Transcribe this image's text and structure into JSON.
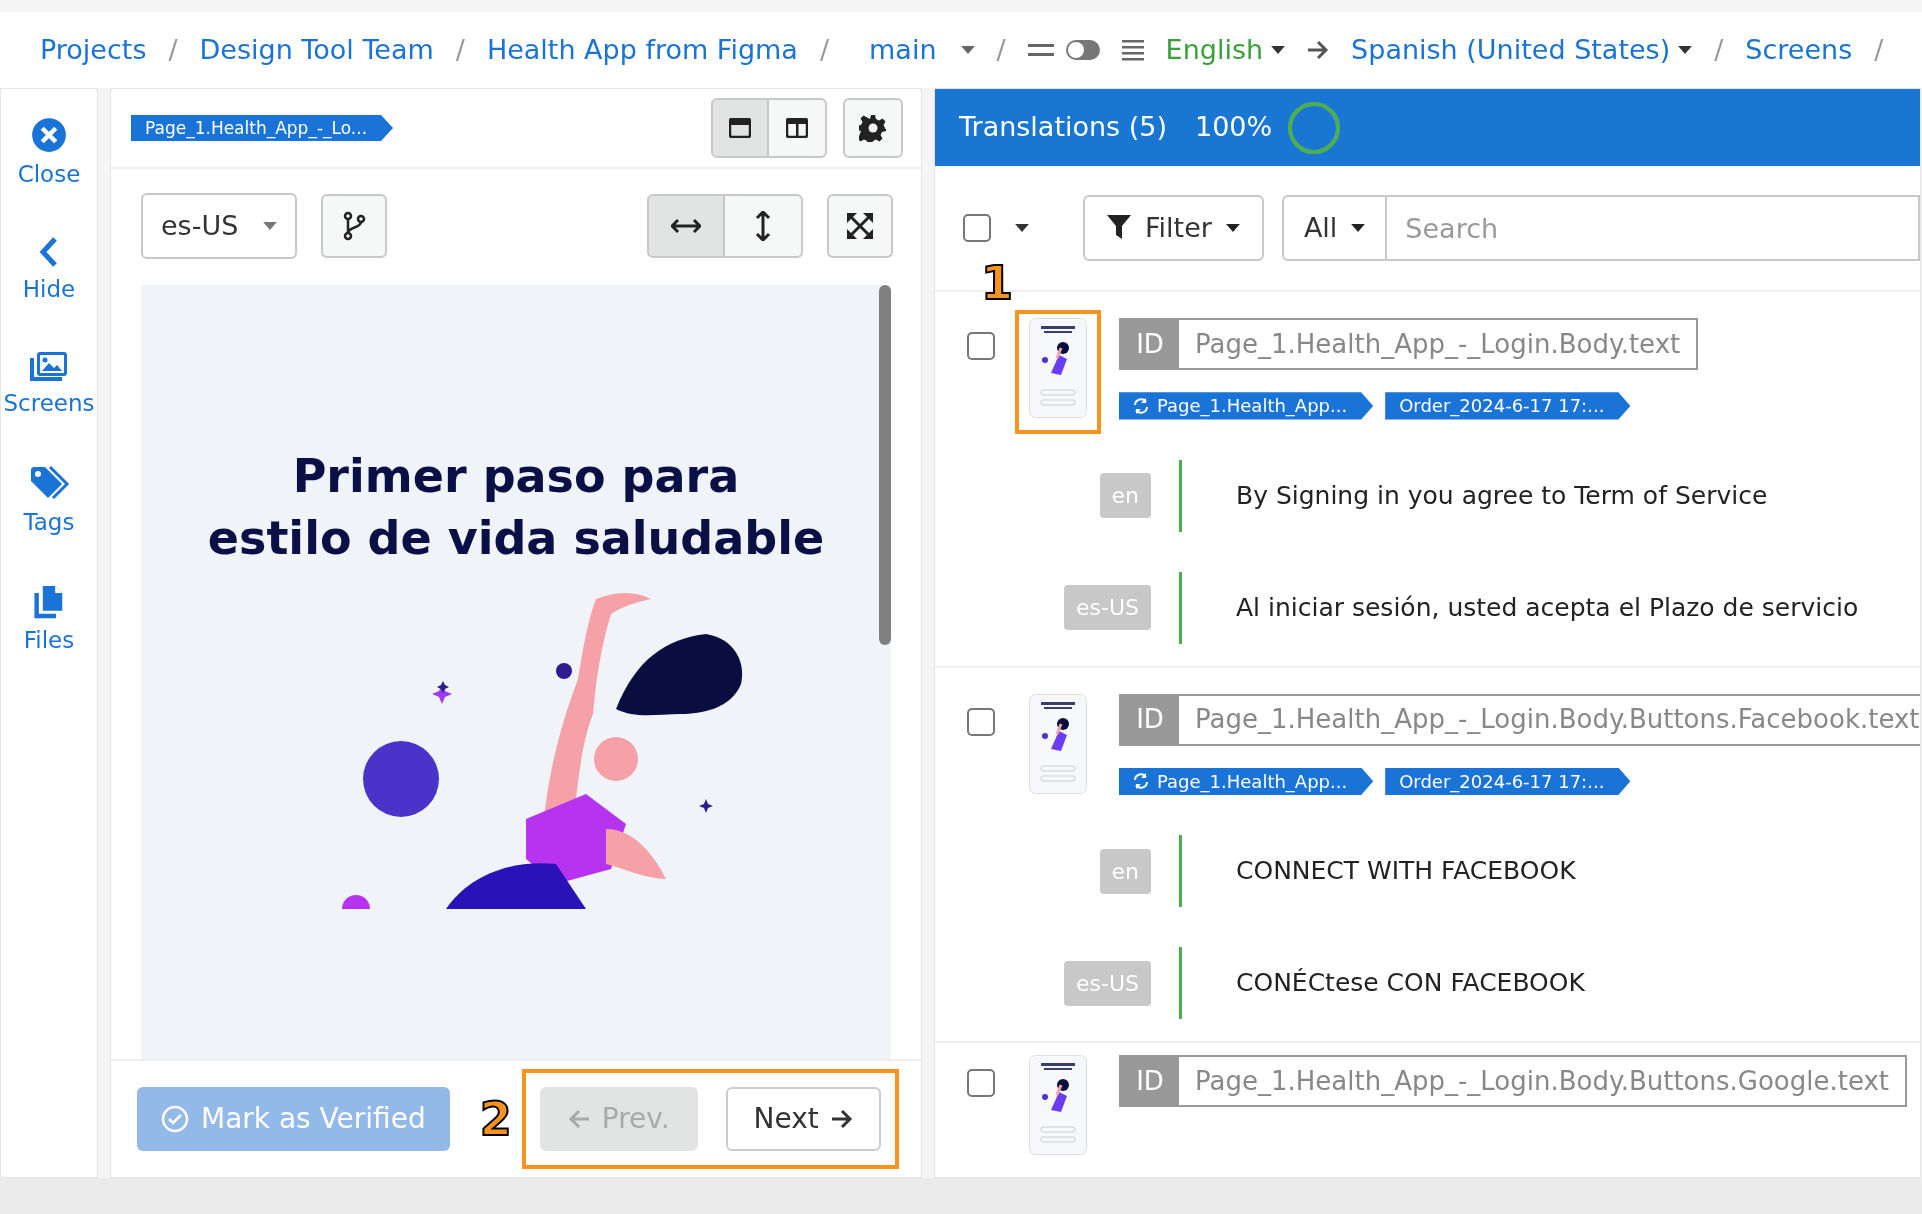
{
  "breadcrumb": {
    "items": [
      {
        "label": "Projects",
        "kind": "link"
      },
      {
        "label": "/",
        "kind": "separator"
      },
      {
        "label": "Design Tool Team",
        "kind": "link"
      },
      {
        "label": "/",
        "kind": "separator"
      },
      {
        "label": "Health App from Figma",
        "kind": "link"
      },
      {
        "label": "/",
        "kind": "separator"
      },
      {
        "label": "main",
        "kind": "dropdown"
      },
      {
        "label": "/",
        "kind": "separator"
      }
    ],
    "view_toggle": {
      "on": false
    },
    "source_language": "English",
    "target_language": "Spanish (United States)",
    "trail": [
      {
        "label": "/",
        "kind": "separator"
      },
      {
        "label": "Screens",
        "kind": "link"
      },
      {
        "label": "/",
        "kind": "separator"
      }
    ]
  },
  "sidebar": {
    "items": [
      {
        "label": "Close",
        "kind": "close"
      },
      {
        "label": "Hide",
        "kind": "hide"
      },
      {
        "label": "Screens",
        "kind": "screens"
      },
      {
        "label": "Tags",
        "kind": "tags"
      },
      {
        "label": "Files",
        "kind": "files"
      }
    ]
  },
  "preview": {
    "screen_tag": "Page_1.Health_App_-_Lo...",
    "layouts": [
      {
        "kind": "single",
        "selected": true
      },
      {
        "kind": "split",
        "selected": false
      }
    ],
    "locale": "es-US",
    "fit": [
      {
        "kind": "width",
        "selected": true
      },
      {
        "kind": "height",
        "selected": false
      }
    ],
    "heading": [
      "Primer paso para",
      "estilo de vida saludable"
    ],
    "mark_verified": {
      "label": "Mark as Verified",
      "disabled": true
    },
    "prev": {
      "label": "Prev.",
      "disabled": true
    },
    "next": {
      "label": "Next",
      "disabled": false
    }
  },
  "translations": {
    "title": "Translations (5)",
    "percent": "100%",
    "level": 1,
    "select_all": {
      "checked": false
    },
    "filter": "Filter",
    "scope": "All",
    "search": {
      "placeholder": "Search"
    },
    "entries": [
      {
        "checked": false,
        "highlighted": true,
        "id_label": "ID",
        "id": "Page_1.Health_App_-_Login.Body.text",
        "tags": [
          {
            "label": "Page_1.Health_App...",
            "kind": "screen"
          },
          {
            "label": "Order_2024-6-17 17:...",
            "kind": "order"
          }
        ],
        "texts": [
          {
            "lang": "en",
            "text": "By Signing in you agree to Term of Service"
          },
          {
            "lang": "es-US",
            "text": "Al iniciar sesión, usted acepta el Plazo de servicio"
          }
        ]
      },
      {
        "checked": false,
        "highlighted": false,
        "id_label": "ID",
        "id": "Page_1.Health_App_-_Login.Body.Buttons.Facebook.text",
        "tags": [
          {
            "label": "Page_1.Health_App...",
            "kind": "screen"
          },
          {
            "label": "Order_2024-6-17 17:...",
            "kind": "order"
          }
        ],
        "texts": [
          {
            "lang": "en",
            "text": "CONNECT WITH FACEBOOK"
          },
          {
            "lang": "es-US",
            "text": "CONÉCtese CON FACEBOOK"
          }
        ]
      },
      {
        "checked": false,
        "highlighted": false,
        "id_label": "ID",
        "id": "Page_1.Health_App_-_Login.Body.Buttons.Google.text"
      }
    ]
  },
  "callouts": [
    {
      "number": "1"
    },
    {
      "number": "2"
    }
  ]
}
